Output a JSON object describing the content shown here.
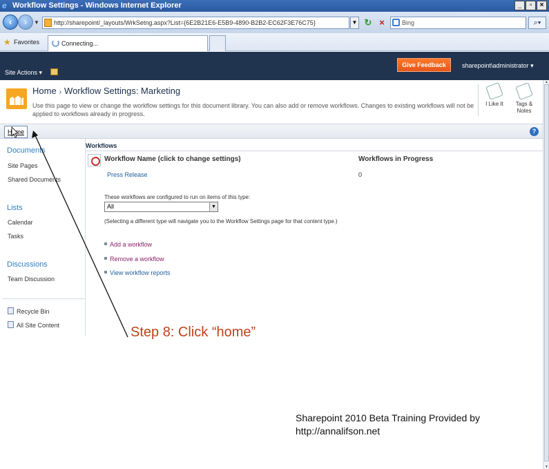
{
  "browser": {
    "window_title": "Workflow Settings - Windows Internet Explorer",
    "url": "http://sharepoint/_layouts/WrkSetng.aspx?List={6E2B21E6-E5B9-4890-B2B2-EC62F3E76C75}",
    "search_placeholder": "Bing",
    "favorites_label": "Favorites",
    "tab_label": "Connecting..."
  },
  "sharepoint": {
    "site_actions": "Site Actions",
    "give_feedback": "Give Feedback",
    "user": "sharepoint\\administrator"
  },
  "page": {
    "breadcrumb_home": "Home",
    "breadcrumb_sep": "›",
    "breadcrumb_current": "Workflow Settings: Marketing",
    "description": "Use this page to view or change the workflow settings for this document library. You can also add or remove workflows. Changes to existing workflows will not be applied to workflows already in progress.",
    "like_label": "I Like It",
    "tags_label": "Tags & Notes",
    "home_tab": "Home",
    "help": "?"
  },
  "leftnav": {
    "documents_heading": "Documents",
    "documents": [
      "Site Pages",
      "Shared Documents"
    ],
    "lists_heading": "Lists",
    "lists": [
      "Calendar",
      "Tasks"
    ],
    "discussions_heading": "Discussions",
    "discussions": [
      "Team Discussion"
    ],
    "recycle_bin": "Recycle Bin",
    "all_site_content": "All Site Content"
  },
  "main": {
    "section_title": "Workflows",
    "col_name": "Workflow Name (click to change settings)",
    "col_progress": "Workflows in Progress",
    "workflows": [
      {
        "name": "Press Release",
        "in_progress": "0"
      }
    ],
    "type_label": "These workflows are configured to run on items of this type:",
    "type_selected": "All",
    "type_note": "(Selecting a different type will navigate you to the Workflow Settings page for that content type.)",
    "add_workflow": "Add a workflow",
    "remove_workflow": "Remove a workflow",
    "view_reports": "View workflow reports"
  },
  "annotation": {
    "step": "Step 8: Click “home”",
    "credit_line1": "Sharepoint 2010 Beta Training Provided by",
    "credit_line2": "http://annalifson.net"
  },
  "colors": {
    "sp_topbar": "#21344f",
    "feedback": "#e4561a",
    "nav_heading": "#2f7fc0",
    "annotation": "#c0401a"
  }
}
